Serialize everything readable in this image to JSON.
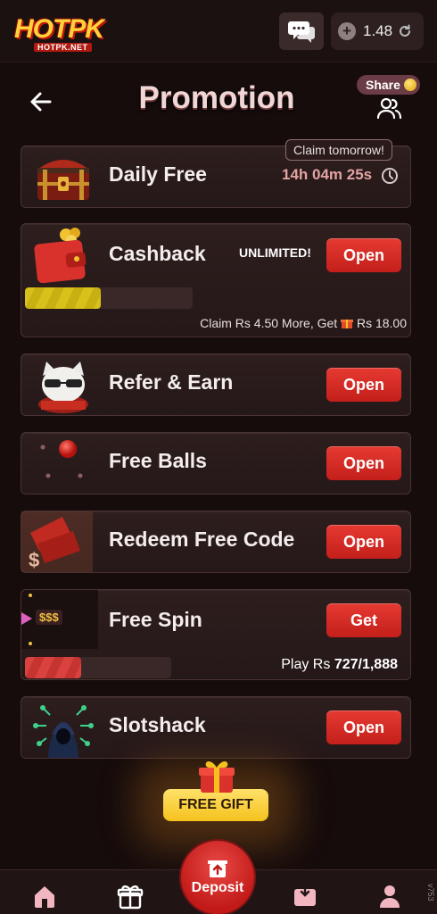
{
  "topbar": {
    "logo_text": "HOTPK",
    "logo_sub": "HOTPK.NET",
    "balance": "1.48"
  },
  "header": {
    "title": "Promotion",
    "share_label": "Share"
  },
  "cards": {
    "daily": {
      "title": "Daily Free",
      "claim_tag": "Claim tomorrow!",
      "timer": "14h 04m 25s"
    },
    "cashback": {
      "title": "Cashback",
      "badge": "UNLIMITED!",
      "button": "Open",
      "progress": 0.45,
      "note_prefix": "Claim Rs 4.50 More, Get",
      "note_amount": "Rs 18.00"
    },
    "refer": {
      "title": "Refer & Earn",
      "button": "Open"
    },
    "balls": {
      "title": "Free Balls",
      "button": "Open"
    },
    "redeem": {
      "title": "Redeem Free Code",
      "button": "Open"
    },
    "spin": {
      "title": "Free Spin",
      "button": "Get",
      "tag": "$$$",
      "progress": 0.385,
      "play_label": "Play Rs",
      "play_value": "727/1,888"
    },
    "slotshack": {
      "title": "Slotshack",
      "button": "Open"
    }
  },
  "free_gift": {
    "label": "FREE GIFT"
  },
  "bottom_nav": {
    "deposit_label": "Deposit",
    "items": [
      "home-icon",
      "gift-icon",
      "deposit-icon",
      "wallet-icon",
      "profile-icon"
    ]
  },
  "version": "v753",
  "colors": {
    "accent_red": "#d6302b",
    "gold": "#f5c21d",
    "bg": "#160c0c"
  }
}
